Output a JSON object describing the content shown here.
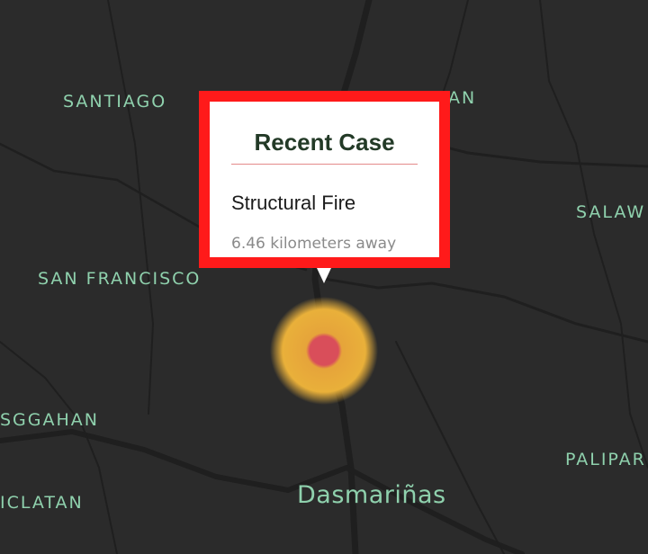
{
  "map": {
    "places": [
      {
        "id": "santiago",
        "label": "SANTIAGO"
      },
      {
        "id": "partial-an",
        "label": "AN"
      },
      {
        "id": "salaw",
        "label": "SALAW"
      },
      {
        "id": "san-francisco",
        "label": "SAN FRANCISCO"
      },
      {
        "id": "sggahan",
        "label": "SGGAHAN"
      },
      {
        "id": "iclatan",
        "label": "ICLATAN"
      },
      {
        "id": "palipar",
        "label": "PALIPAR"
      }
    ],
    "city_label": "Dasmariñas",
    "colors": {
      "background": "#2b2b2b",
      "roads": "#1d1d1d",
      "labels": "#8fd1ad"
    }
  },
  "popup": {
    "title": "Recent Case",
    "incident_type": "Structural Fire",
    "distance": "6.46 kilometers away",
    "highlight_color": "#ff1a1a"
  },
  "marker": {
    "inner_color": "#d94e5a",
    "outer_color": "#e9b03a"
  }
}
